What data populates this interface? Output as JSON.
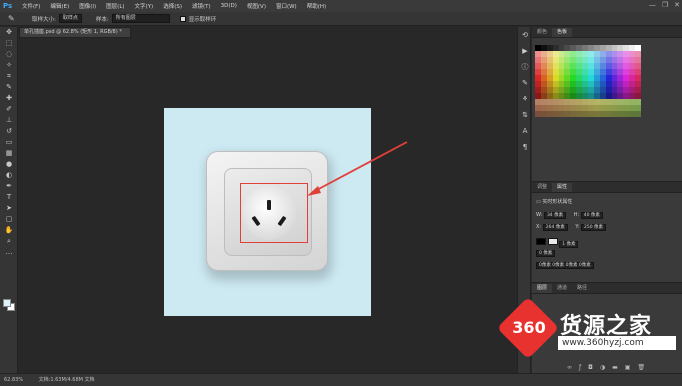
{
  "menubar": {
    "logo": "Ps",
    "items": [
      "文件(F)",
      "编辑(E)",
      "图像(I)",
      "图层(L)",
      "文字(Y)",
      "选择(S)",
      "滤镜(T)",
      "3D(D)",
      "视图(V)",
      "窗口(W)",
      "帮助(H)"
    ],
    "window_controls": [
      "—",
      "❐",
      "✕"
    ]
  },
  "options_bar": {
    "sample_size_label": "取样大小:",
    "sample_size_value": "取样点",
    "sample_label": "样本:",
    "sample_value": "所有图层",
    "show_ring_label": "显示取样环"
  },
  "document_tab": {
    "title": "单孔插座.psd @ 62.8% (矩形 1, RGB/8) *",
    "close": "×"
  },
  "panels": {
    "swatch_tabs": [
      "颜色",
      "色板"
    ],
    "props_tabs": [
      "调整",
      "属性"
    ],
    "props_title": "实时形状属性",
    "w_label": "W:",
    "w_value": "34 像素",
    "h_label": "H:",
    "h_value": "40 像素",
    "x_label": "X:",
    "x_value": "264 像素",
    "y_label": "Y:",
    "y_value": "250 像素",
    "stroke_value": "1 像素",
    "radius_value": "0 像素",
    "corners_value": "0像素 0像素 0像素 0像素",
    "layers_tabs": [
      "图层",
      "通道",
      "路径"
    ]
  },
  "statusbar": {
    "zoom": "62.83%",
    "doc": "文档:1.63M/4.68M 文档"
  },
  "watermark": {
    "badge": "360",
    "title": "货源之家",
    "url": "www.360hyzj.com"
  },
  "colors": {
    "canvas_bg": "#cde9f2",
    "highlight": "#e0403a",
    "watermark_red": "#e8322f"
  }
}
